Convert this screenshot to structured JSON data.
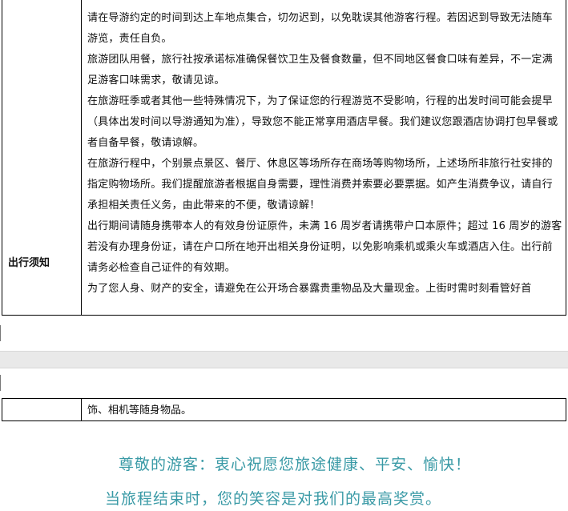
{
  "section": {
    "label": "出行须知",
    "paragraphs": [
      "请在导游约定的时间到达上车地点集合，切勿迟到，以免耽误其他游客行程。若因迟到导致无法随车游览，责任自负。",
      "旅游团队用餐，旅行社按承诺标准确保餐饮卫生及餐食数量，但不同地区餐食口味有差异，不一定满足游客口味需求，敬请见谅。",
      "在旅游旺季或者其他一些特殊情况下，为了保证您的行程游览不受影响，行程的出发时间可能会提早（具体出发时间以导游通知为准），导致您不能正常享用酒店早餐。我们建议您跟酒店协调打包早餐或者自备早餐，敬请谅解。",
      "在旅游行程中，个别景点景区、餐厅、休息区等场所存在商场等购物场所，上述场所非旅行社安排的指定购物场所。我们提醒旅游者根据自身需要，理性消费并索要必要票据。如产生消费争议，请自行承担相关责任义务，由此带来的不便，敬请谅解！",
      "出行期间请随身携带本人的有效身份证原件，未满 16 周岁者请携带户口本原件；超过 16 周岁的游客若没有办理身份证，请在户口所在地开出相关身份证明，以免影响乘机或乘火车或酒店入住。出行前请务必检查自己证件的有效期。",
      "为了您人身、财产的安全，请避免在公开场合暴露贵重物品及大量现金。上街时需时刻看管好首"
    ],
    "continued_text": "饰、相机等随身物品。"
  },
  "closing": {
    "line1": "尊敬的游客：衷心祝愿您旅途健康、平安、愉快！",
    "line2": "当旅程结束时，您的笑容是对我们的最高奖赏。"
  },
  "colors": {
    "closing_text": "#3a9aa6",
    "page_break": "#e9e9e9"
  }
}
